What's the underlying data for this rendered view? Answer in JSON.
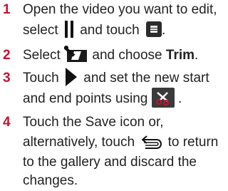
{
  "steps": [
    {
      "number": "1",
      "line1_a": "Open the video you want to edit,",
      "line2_a": "select",
      "line2_b": "and touch",
      "line2_c": ".",
      "icons": [
        "pause-icon",
        "menu-icon"
      ]
    },
    {
      "number": "2",
      "a": "Select",
      "b": "and choose",
      "bold": "Trim",
      "c": ".",
      "icons": [
        "video-edit-icon"
      ]
    },
    {
      "number": "3",
      "line1_a": "Touch",
      "line1_b": "and set the new start",
      "line2_a": "and end points using",
      "line2_b": ".",
      "icons": [
        "play-icon",
        "scissors-icon"
      ]
    },
    {
      "number": "4",
      "line1": "Touch the Save icon or,",
      "line2_a": "alternatively, touch",
      "line2_b": "to return",
      "line3": "to the gallery and discard the",
      "line4": "changes.",
      "icons": [
        "back-icon"
      ]
    }
  ],
  "colors": {
    "step_number": "#c8102e",
    "text": "#222222"
  }
}
